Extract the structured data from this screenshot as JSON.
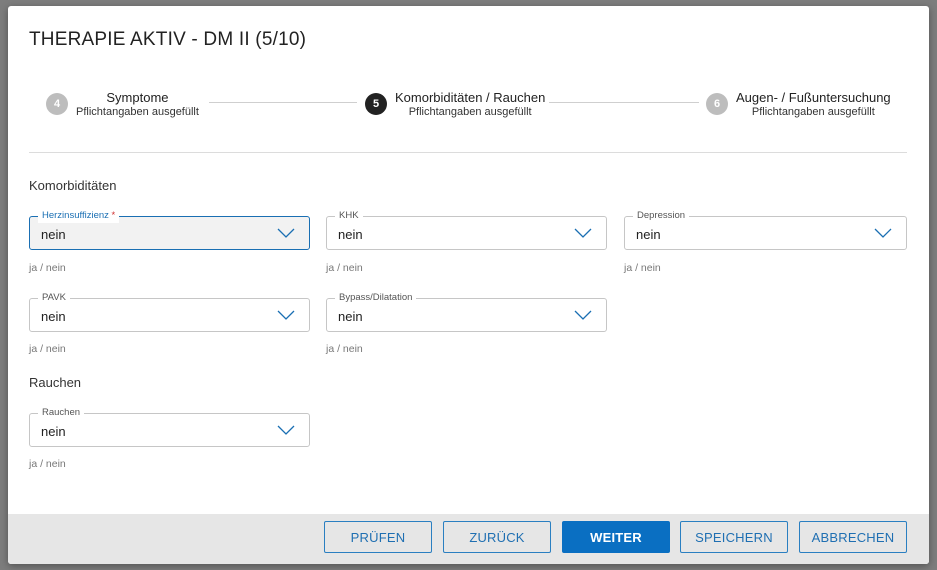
{
  "dialog": {
    "title": "THERAPIE AKTIV - DM II (5/10)"
  },
  "stepper": {
    "steps": [
      {
        "number": "4",
        "title": "Symptome",
        "subtitle": "Pflichtangaben ausgefüllt",
        "state": "inactive"
      },
      {
        "number": "5",
        "title": "Komorbiditäten / Rauchen",
        "subtitle": "Pflichtangaben ausgefüllt",
        "state": "active"
      },
      {
        "number": "6",
        "title": "Augen- / Fußuntersuchung",
        "subtitle": "Pflichtangaben ausgefüllt",
        "state": "inactive"
      }
    ]
  },
  "sections": {
    "komorbiditaeten": {
      "title": "Komorbiditäten",
      "fields": [
        {
          "label": "Herzinsuffizienz",
          "required_mark": "*",
          "value": "nein",
          "hint": "ja / nein"
        },
        {
          "label": "KHK",
          "value": "nein",
          "hint": "ja / nein"
        },
        {
          "label": "Depression",
          "value": "nein",
          "hint": "ja / nein"
        },
        {
          "label": "PAVK",
          "value": "nein",
          "hint": "ja / nein"
        },
        {
          "label": "Bypass/Dilatation",
          "value": "nein",
          "hint": "ja / nein"
        }
      ]
    },
    "rauchen": {
      "title": "Rauchen",
      "fields": [
        {
          "label": "Rauchen",
          "value": "nein",
          "hint": "ja / nein"
        }
      ]
    }
  },
  "footer": {
    "buttons": {
      "pruefen": "PRÜFEN",
      "zurueck": "ZURÜCK",
      "weiter": "WEITER",
      "speichern": "SPEICHERN",
      "abbrechen": "ABBRECHEN"
    }
  },
  "colors": {
    "accent": "#0a6fc2",
    "focus_border": "#1a6fb3",
    "required": "#d03030",
    "step_active": "#222222",
    "step_inactive": "#bdbdbd"
  },
  "icons": {
    "dropdown": "chevron-down-icon"
  }
}
